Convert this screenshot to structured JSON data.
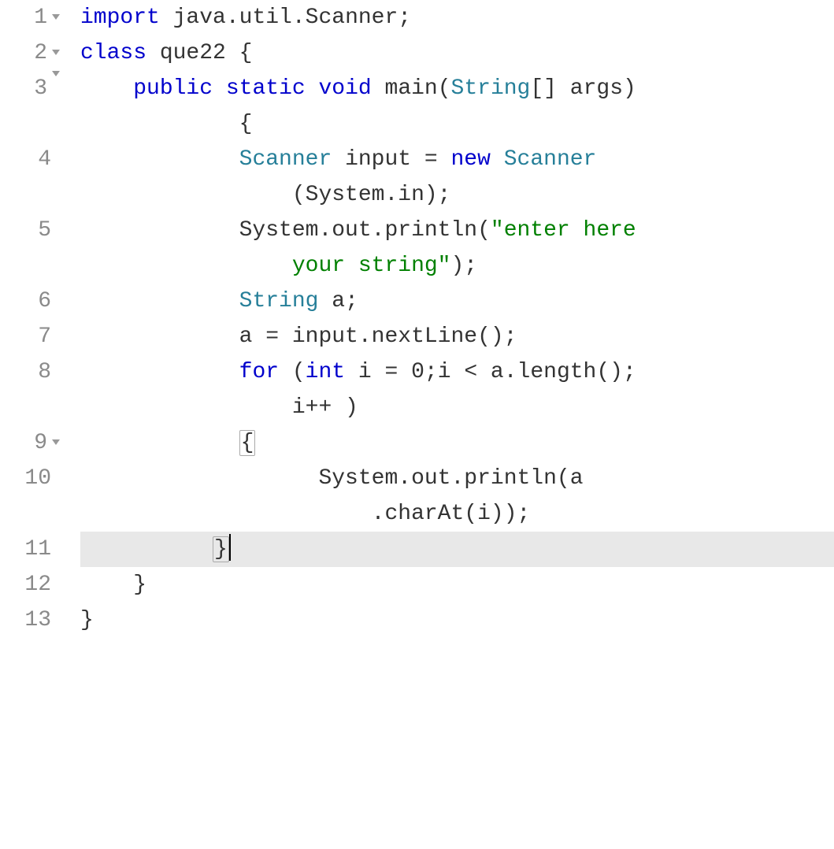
{
  "lines": [
    {
      "num": "1",
      "fold": true,
      "tall": false,
      "tokens": [
        {
          "cls": "kw",
          "text": "import"
        },
        {
          "cls": "plain",
          "text": " java.util.Scanner;"
        }
      ]
    },
    {
      "num": "2",
      "fold": true,
      "tall": false,
      "tokens": [
        {
          "cls": "kw",
          "text": "class"
        },
        {
          "cls": "plain",
          "text": " que22 {"
        }
      ]
    },
    {
      "num": "3",
      "fold": true,
      "tall": true,
      "tokens": [
        {
          "cls": "plain",
          "text": "    "
        },
        {
          "cls": "kw",
          "text": "public"
        },
        {
          "cls": "plain",
          "text": " "
        },
        {
          "cls": "kw",
          "text": "static"
        },
        {
          "cls": "plain",
          "text": " "
        },
        {
          "cls": "kw",
          "text": "void"
        },
        {
          "cls": "plain",
          "text": " main("
        },
        {
          "cls": "type",
          "text": "String"
        },
        {
          "cls": "plain",
          "text": "[] args)\n            {"
        }
      ]
    },
    {
      "num": "4",
      "fold": false,
      "tall": true,
      "tokens": [
        {
          "cls": "plain",
          "text": "            "
        },
        {
          "cls": "type",
          "text": "Scanner"
        },
        {
          "cls": "plain",
          "text": " input = "
        },
        {
          "cls": "kw",
          "text": "new"
        },
        {
          "cls": "plain",
          "text": " "
        },
        {
          "cls": "type",
          "text": "Scanner"
        },
        {
          "cls": "plain",
          "text": "\n                (System.in);"
        }
      ]
    },
    {
      "num": "5",
      "fold": false,
      "tall": true,
      "tokens": [
        {
          "cls": "plain",
          "text": "            System.out.println("
        },
        {
          "cls": "str",
          "text": "\"enter here\n                your string\""
        },
        {
          "cls": "plain",
          "text": ");"
        }
      ]
    },
    {
      "num": "6",
      "fold": false,
      "tall": false,
      "tokens": [
        {
          "cls": "plain",
          "text": "            "
        },
        {
          "cls": "type",
          "text": "String"
        },
        {
          "cls": "plain",
          "text": " a;"
        }
      ]
    },
    {
      "num": "7",
      "fold": false,
      "tall": false,
      "tokens": [
        {
          "cls": "plain",
          "text": "            a = input.nextLine();"
        }
      ]
    },
    {
      "num": "8",
      "fold": false,
      "tall": true,
      "tokens": [
        {
          "cls": "plain",
          "text": "            "
        },
        {
          "cls": "kw",
          "text": "for"
        },
        {
          "cls": "plain",
          "text": " ("
        },
        {
          "cls": "kw",
          "text": "int"
        },
        {
          "cls": "plain",
          "text": " i = 0;i < a.length();\n                i++ )"
        }
      ]
    },
    {
      "num": "9",
      "fold": true,
      "tall": false,
      "tokens": [
        {
          "cls": "plain",
          "text": "            "
        },
        {
          "cls": "plain",
          "text": "{",
          "bracket": true
        }
      ]
    },
    {
      "num": "10",
      "fold": false,
      "tall": true,
      "tokens": [
        {
          "cls": "plain",
          "text": "                  System.out.println(a\n                      .charAt(i));"
        }
      ]
    },
    {
      "num": "11",
      "fold": false,
      "tall": false,
      "active": true,
      "tokens": [
        {
          "cls": "plain",
          "text": "          "
        },
        {
          "cls": "plain",
          "text": "}",
          "bracket": true
        },
        {
          "cls": "plain",
          "text": "",
          "cursor": true
        }
      ]
    },
    {
      "num": "12",
      "fold": false,
      "tall": false,
      "tokens": [
        {
          "cls": "plain",
          "text": "    }"
        }
      ]
    },
    {
      "num": "13",
      "fold": false,
      "tall": false,
      "tokens": [
        {
          "cls": "plain",
          "text": "}"
        }
      ]
    }
  ],
  "indent_guides": [
    95,
    145
  ]
}
